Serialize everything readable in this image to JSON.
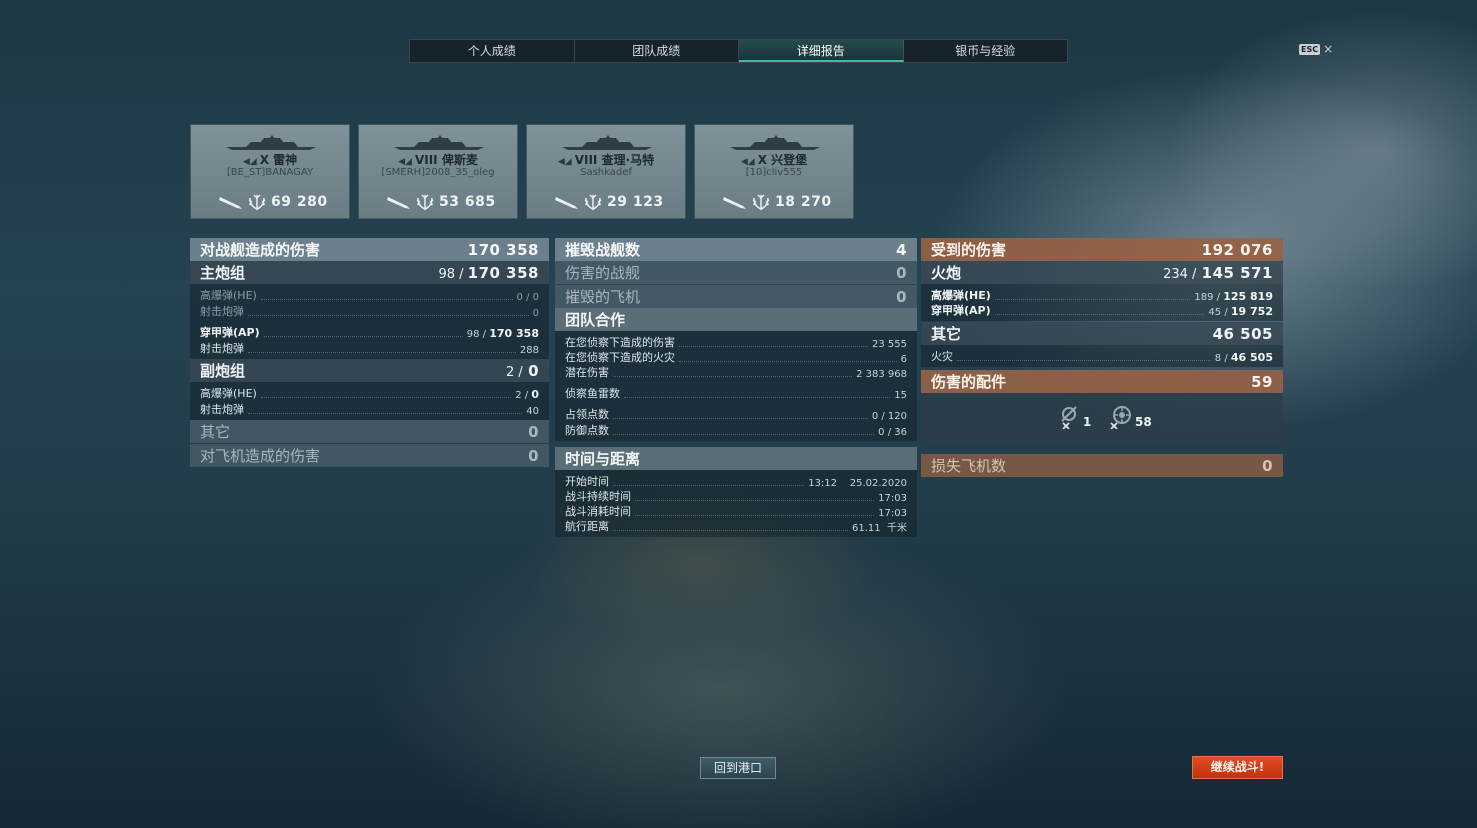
{
  "tabs": [
    {
      "label": "个人成绩",
      "active": false
    },
    {
      "label": "团队成绩",
      "active": false
    },
    {
      "label": "详细报告",
      "active": true
    },
    {
      "label": "银币与经验",
      "active": false
    }
  ],
  "esc": {
    "key": "ESC",
    "close": "×"
  },
  "ships": [
    {
      "tier": "X",
      "name": "雷神",
      "player": "[BE_ST]BANAGAY",
      "damage": "69 280"
    },
    {
      "tier": "VIII",
      "name": "俾斯麦",
      "player": "[SMERH]2008_35_oleg",
      "damage": "53 685"
    },
    {
      "tier": "VIII",
      "name": "查理·马特",
      "player": "Sashkadef",
      "damage": "29 123"
    },
    {
      "tier": "X",
      "name": "兴登堡",
      "player": "[10]cliv555",
      "damage": "18 270"
    }
  ],
  "left": {
    "ship_damage": {
      "label": "对战舰造成的伤害",
      "value": "170 358"
    },
    "main": {
      "label": "主炮组",
      "hits": "98",
      "value": "170 358",
      "he": {
        "label": "高爆弹(HE)",
        "value": "0 / 0"
      },
      "he_shots": {
        "label": "射击炮弹",
        "value": "0"
      },
      "ap": {
        "label": "穿甲弹(AP)",
        "hits": "98 /",
        "value": "170 358"
      },
      "ap_shots": {
        "label": "射击炮弹",
        "value": "288"
      }
    },
    "secondary": {
      "label": "副炮组",
      "hits": "2 /",
      "value": "0",
      "he": {
        "label": "高爆弹(HE)",
        "hits": "2 /",
        "value": "0"
      },
      "shots": {
        "label": "射击炮弹",
        "value": "40"
      }
    },
    "other": {
      "label": "其它",
      "value": "0"
    },
    "aircraft_damage": {
      "label": "对飞机造成的伤害",
      "value": "0"
    }
  },
  "middle": {
    "ships_destroyed": {
      "label": "摧毁战舰数",
      "value": "4"
    },
    "ships_damaged": {
      "label": "伤害的战舰",
      "value": "0"
    },
    "planes_destroyed": {
      "label": "摧毁的飞机",
      "value": "0"
    },
    "team": {
      "label": "团队合作",
      "lines": [
        {
          "label": "在您侦察下造成的伤害",
          "value": "23 555"
        },
        {
          "label": "在您侦察下造成的火灾",
          "value": "6"
        },
        {
          "label": "潜在伤害",
          "value": "2 383 968"
        },
        {
          "label": "侦察鱼雷数",
          "value": "15"
        },
        {
          "label": "占领点数",
          "value": "0 / 120"
        },
        {
          "label": "防御点数",
          "value": "0 / 36"
        }
      ]
    },
    "time": {
      "label": "时间与距离",
      "lines": [
        {
          "label": "开始时间",
          "value": "13:12    25.02.2020"
        },
        {
          "label": "战斗持续时间",
          "value": "17:03"
        },
        {
          "label": "战斗消耗时间",
          "value": "17:03"
        },
        {
          "label": "航行距离",
          "value": "61.11  千米"
        }
      ]
    }
  },
  "right": {
    "received": {
      "label": "受到的伤害",
      "value": "192 076"
    },
    "artillery": {
      "label": "火炮",
      "hits": "234 /",
      "value": "145 571",
      "he": {
        "label": "高爆弹(HE)",
        "hits": "189 /",
        "value": "125 819"
      },
      "ap": {
        "label": "穿甲弹(AP)",
        "hits": "45 /",
        "value": "19 752"
      }
    },
    "other": {
      "label": "其它",
      "value": "46 505",
      "fire": {
        "label": "火灾",
        "hits": "8 /",
        "value": "46 505"
      }
    },
    "modules": {
      "label": "伤害的配件",
      "value": "59",
      "items": [
        {
          "icon": "damaged-module-icon",
          "count": "1"
        },
        {
          "icon": "damaged-turret-icon",
          "count": "58"
        }
      ]
    },
    "planes_lost": {
      "label": "损失飞机数",
      "value": "0"
    }
  },
  "buttons": {
    "port": "回到港口",
    "battle": "继续战斗!"
  }
}
